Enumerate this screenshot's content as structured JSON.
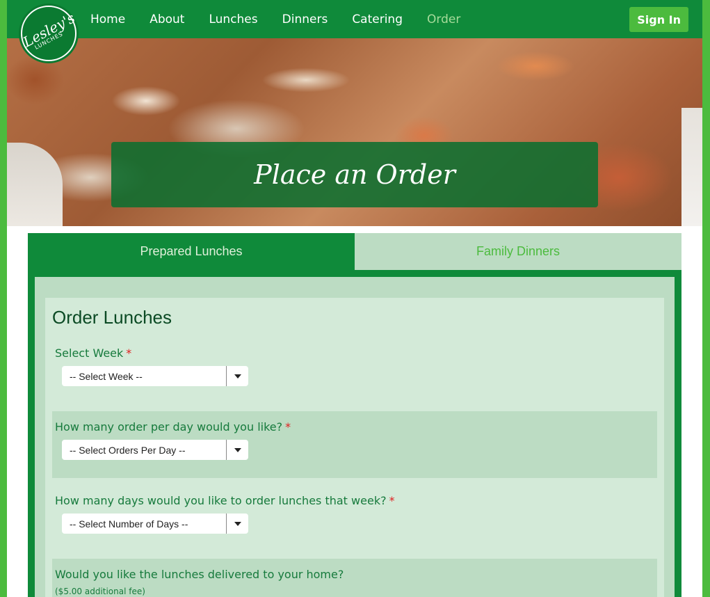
{
  "nav": {
    "logo": {
      "main": "Lesley's",
      "sub": "LUNCHES"
    },
    "links": [
      "Home",
      "About",
      "Lunches",
      "Dinners",
      "Catering",
      "Order"
    ],
    "active": "Order",
    "signin_label": "Sign In"
  },
  "hero": {
    "title": "Place an Order"
  },
  "tabs": [
    {
      "label": "Prepared Lunches",
      "active": true
    },
    {
      "label": "Family Dinners",
      "active": false
    }
  ],
  "form": {
    "title": "Order Lunches",
    "required_mark": "*",
    "fields": [
      {
        "label": "Select Week",
        "value": "-- Select Week --",
        "required": true
      },
      {
        "label": "How many order per day would you like?",
        "value": "-- Select Orders Per Day --",
        "required": true
      },
      {
        "label": "How many days would you like to order lunches that week?",
        "value": "-- Select Number of Days --",
        "required": true
      },
      {
        "label": "Would you like the lunches delivered to your home?",
        "note": "($5.00 additional fee)",
        "required": false
      }
    ]
  },
  "colors": {
    "nav_green": "#0f8a3a",
    "accent_green": "#4cbb3e",
    "panel_light": "#d3ead8",
    "panel_shade": "#bcdcc3",
    "required_red": "#e02020"
  }
}
